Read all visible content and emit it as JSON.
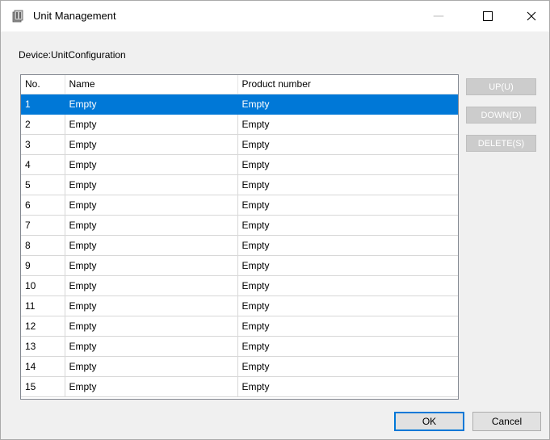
{
  "window": {
    "title": "Unit Management",
    "icon": "unit-management-app-icon",
    "controls": {
      "minimize": "—",
      "maximize": "☐",
      "close": "✕"
    }
  },
  "device_label": "Device:UnitConfiguration",
  "table": {
    "columns": [
      "No.",
      "Name",
      "Product number"
    ],
    "selected_row": 0,
    "rows": [
      [
        "1",
        "Empty",
        "Empty"
      ],
      [
        "2",
        "Empty",
        "Empty"
      ],
      [
        "3",
        "Empty",
        "Empty"
      ],
      [
        "4",
        "Empty",
        "Empty"
      ],
      [
        "5",
        "Empty",
        "Empty"
      ],
      [
        "6",
        "Empty",
        "Empty"
      ],
      [
        "7",
        "Empty",
        "Empty"
      ],
      [
        "8",
        "Empty",
        "Empty"
      ],
      [
        "9",
        "Empty",
        "Empty"
      ],
      [
        "10",
        "Empty",
        "Empty"
      ],
      [
        "11",
        "Empty",
        "Empty"
      ],
      [
        "12",
        "Empty",
        "Empty"
      ],
      [
        "13",
        "Empty",
        "Empty"
      ],
      [
        "14",
        "Empty",
        "Empty"
      ],
      [
        "15",
        "Empty",
        "Empty"
      ]
    ]
  },
  "side_buttons": {
    "up": "UP(U)",
    "down": "DOWN(D)",
    "delete": "DELETE(S)",
    "enabled": false
  },
  "footer": {
    "ok": "OK",
    "cancel": "Cancel"
  },
  "colors": {
    "selection": "#0078d7",
    "default_button_border": "#0078d7",
    "disabled_button": "#cccccc"
  }
}
